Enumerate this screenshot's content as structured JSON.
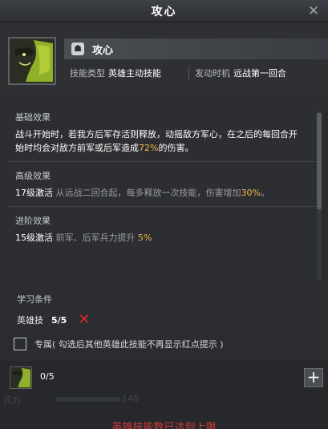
{
  "window": {
    "title": "攻心"
  },
  "skill": {
    "name": "攻心",
    "type_label": "技能类型",
    "type_value": "英雄主动技能",
    "trigger_label": "发动时机",
    "trigger_value": "远战第一回合"
  },
  "sections": {
    "basic": {
      "title": "基础效果",
      "text_before": "战斗开始时，若我方后军存活则释放，动摇敌方军心，在之后的每回合开始时均会对敌方前军或后军造成",
      "highlight": "72%",
      "text_after": "的伤害。"
    },
    "advanced": {
      "title": "高级效果",
      "activate": "17级激活",
      "desc": "从远战二回合起，每多释放一次技能，伤害增加",
      "highlight": "30%",
      "end": "。"
    },
    "progress": {
      "title": "进阶效果",
      "activate": "15级激活",
      "desc": "前军、后军兵力提升",
      "highlight": "5%"
    }
  },
  "learn": {
    "title": "学习条件",
    "req_label": "英雄技",
    "req_value": "5/5"
  },
  "exclusive": {
    "label": "专属( 勾选后其他英雄此技能不再显示红点提示 )"
  },
  "bottom": {
    "count": "0/5",
    "faded_left": "兵力",
    "faded_num": "140",
    "warning": "英雄技能数已达到上限"
  },
  "colors": {
    "highlight": "#f2b84a",
    "warning": "#d83a3a",
    "cross": "#e02a2a"
  }
}
